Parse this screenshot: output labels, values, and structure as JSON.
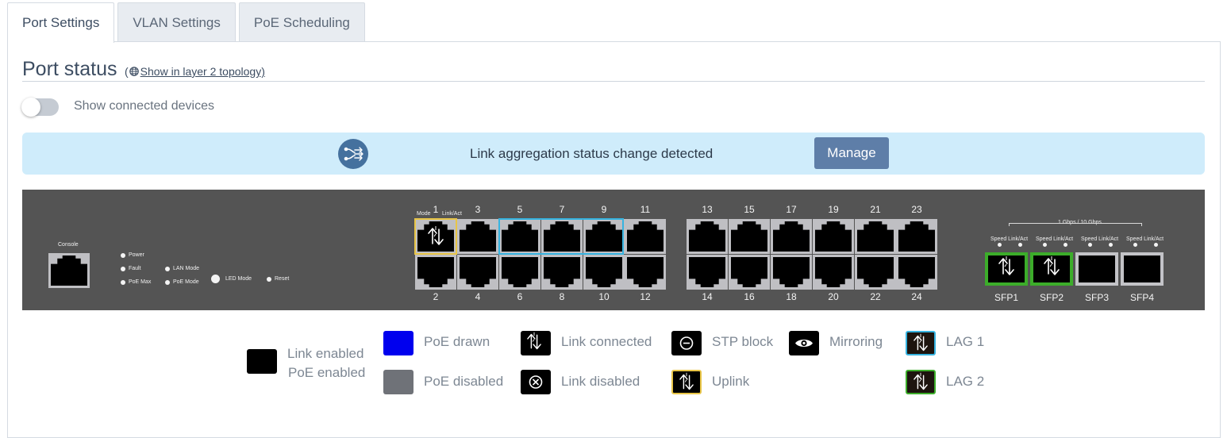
{
  "tabs": [
    {
      "label": "Port Settings"
    },
    {
      "label": "VLAN Settings"
    },
    {
      "label": "PoE Scheduling"
    }
  ],
  "header": {
    "title": "Port status",
    "topology_open": "(",
    "topology_link": "Show in layer 2 topology)"
  },
  "toggle": {
    "label": "Show connected devices"
  },
  "banner": {
    "text": "Link aggregation status change detected",
    "button": "Manage"
  },
  "switch": {
    "console": "Console",
    "leds": {
      "power": "Power",
      "fault": "Fault",
      "poe_max": "PoE Max",
      "lan_mode": "LAN Mode",
      "poe_mode": "PoE Mode",
      "led_mode": "LED Mode",
      "reset": "Reset"
    },
    "mode": "Mode",
    "link_act": "Link/Act",
    "sfp_header": "1 Gbps / 10 Gbps",
    "speed_label": "Speed Link/Act",
    "ports_top": [
      "1",
      "3",
      "5",
      "7",
      "9",
      "11",
      "13",
      "15",
      "17",
      "19",
      "21",
      "23"
    ],
    "ports_bottom": [
      "2",
      "4",
      "6",
      "8",
      "10",
      "12",
      "14",
      "16",
      "18",
      "20",
      "22",
      "24"
    ],
    "sfp": [
      "SFP1",
      "SFP2",
      "SFP3",
      "SFP4"
    ]
  },
  "legend": {
    "link_enabled": "Link enabled",
    "poe_enabled": "PoE enabled",
    "poe_drawn": "PoE drawn",
    "poe_disabled": "PoE disabled",
    "link_connected": "Link connected",
    "link_disabled": "Link disabled",
    "stp_block": "STP block",
    "uplink": "Uplink",
    "mirroring": "Mirroring",
    "lag1": "LAG 1",
    "lag2": "LAG 2"
  },
  "colors": {
    "tab_inactive": "#e8ecf1",
    "banner_bg": "#cfecfb",
    "manage_button": "#5e7ea8",
    "switch_body": "#545454",
    "poe_drawn": "#0000ee",
    "poe_disabled": "#6f7278",
    "uplink": "#e8c547",
    "lag1": "#36b3e0",
    "lag2": "#3cad2a"
  }
}
